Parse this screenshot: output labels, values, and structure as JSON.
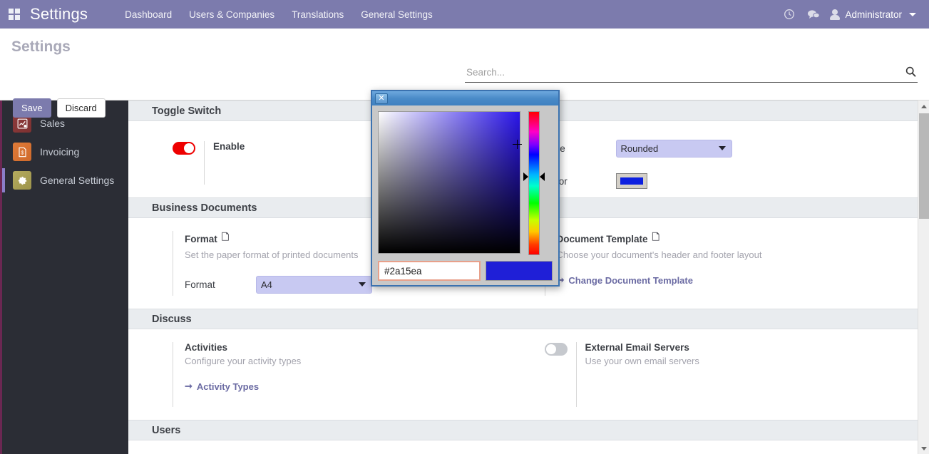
{
  "navbar": {
    "apps_icon": "apps-grid-icon",
    "brand": "Settings",
    "menu": [
      {
        "label": "Dashboard"
      },
      {
        "label": "Users & Companies"
      },
      {
        "label": "Translations"
      },
      {
        "label": "General Settings"
      }
    ],
    "clock_icon": "◴",
    "chat_icon": "💬",
    "user_name": "Administrator",
    "accent_color": "#7c7bad"
  },
  "control_panel": {
    "breadcrumb": "Settings",
    "save_label": "Save",
    "discard_label": "Discard",
    "search_placeholder": "Search...",
    "search_value": "",
    "search_icon": "🔍"
  },
  "sidebar": {
    "items": [
      {
        "label": "Sales",
        "icon": "chart-icon",
        "glyph": "↗",
        "active": false
      },
      {
        "label": "Invoicing",
        "icon": "invoice-icon",
        "glyph": "🗎",
        "active": false
      },
      {
        "label": "General Settings",
        "icon": "gear-icon",
        "glyph": "⚙",
        "active": true
      }
    ]
  },
  "sections": [
    {
      "title": "Toggle Switch",
      "left": {
        "toggle_state": "on",
        "title": "Enable",
        "desc": "",
        "link": ""
      },
      "right": {
        "type_label": "Type",
        "type_value": "Rounded",
        "type_options": [
          "Rounded"
        ],
        "color_label": "Color",
        "color_value": "#0d20e0"
      }
    },
    {
      "title": "Business Documents",
      "left": {
        "title": "Format",
        "icon": "document-icon",
        "desc": "Set the paper format of printed documents",
        "field_label": "Format",
        "field_value": "A4",
        "field_options": [
          "A4"
        ]
      },
      "right": {
        "title": "Document Template",
        "icon": "document-icon",
        "desc": "Choose your document's header and footer layout",
        "link": "Change Document Template"
      }
    },
    {
      "title": "Discuss",
      "left": {
        "title": "Activities",
        "desc": "Configure your activity types",
        "link": "Activity Types"
      },
      "right": {
        "toggle_state": "off",
        "title": "External Email Servers",
        "desc": "Use your own email servers"
      }
    },
    {
      "title": "Users"
    }
  ],
  "color_dialog": {
    "close_label": "✕",
    "hex_value": "#2a15ea",
    "preview_color": "#1f1fd7",
    "base_hue_color": "#2a15ea"
  }
}
